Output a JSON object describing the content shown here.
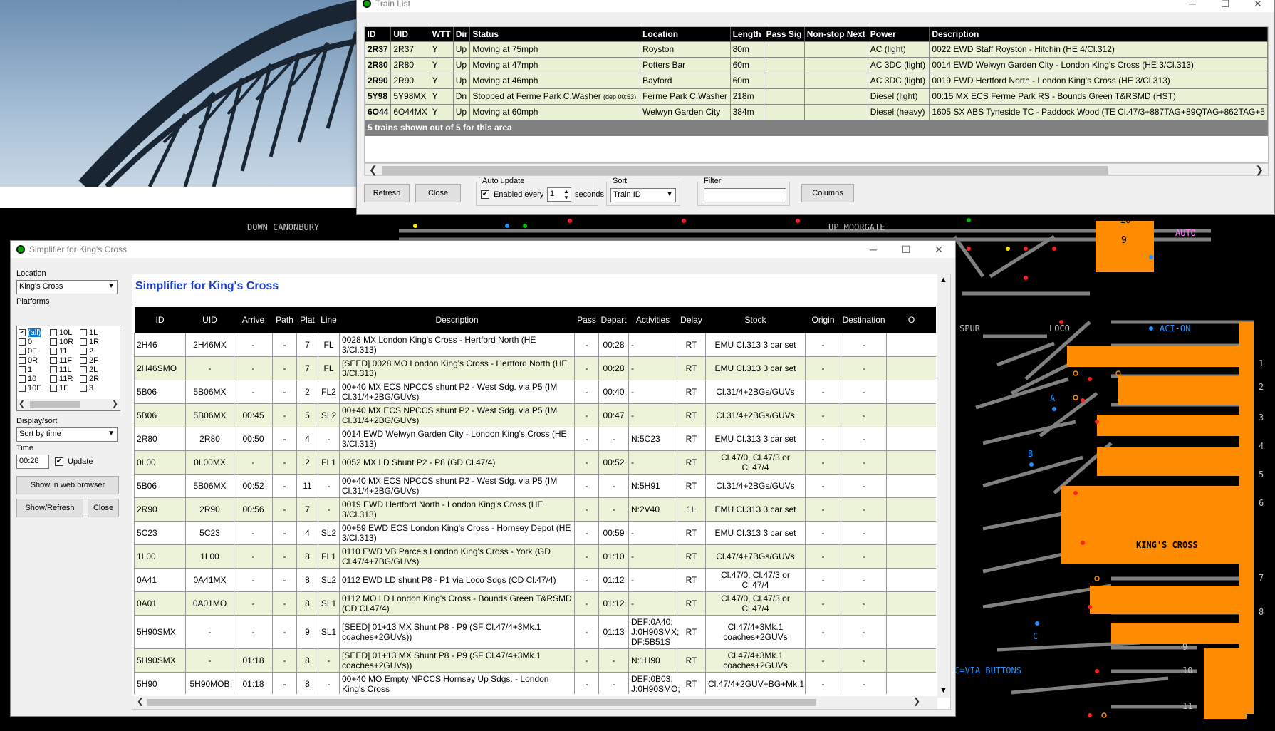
{
  "train_list": {
    "title": "Train List",
    "columns": [
      "ID",
      "UID",
      "WTT",
      "Dir",
      "Status",
      "Location",
      "Length",
      "Pass Sig",
      "Non-stop Next",
      "Power",
      "Description"
    ],
    "rows": [
      {
        "id": "2R37",
        "uid": "2R37",
        "wtt": "Y",
        "dir": "Up",
        "status": "Moving at 75mph",
        "status_note": "",
        "location": "Royston",
        "length": "80m",
        "pass_sig": "",
        "nonstop": "",
        "power": "AC (light)",
        "description": "0022 EWD Staff Royston - Hitchin (HE 4/Cl.312)"
      },
      {
        "id": "2R80",
        "uid": "2R80",
        "wtt": "Y",
        "dir": "Up",
        "status": "Moving at 47mph",
        "status_note": "",
        "location": "Potters Bar",
        "length": "60m",
        "pass_sig": "",
        "nonstop": "",
        "power": "AC 3DC (light)",
        "description": "0014 EWD Welwyn Garden City - London King's Cross (HE 3/Cl.313)"
      },
      {
        "id": "2R90",
        "uid": "2R90",
        "wtt": "Y",
        "dir": "Up",
        "status": "Moving at 46mph",
        "status_note": "",
        "location": "Bayford",
        "length": "60m",
        "pass_sig": "",
        "nonstop": "",
        "power": "AC 3DC (light)",
        "description": "0019 EWD Hertford North - London King's Cross (HE 3/Cl.313)"
      },
      {
        "id": "5Y98",
        "uid": "5Y98MX",
        "wtt": "Y",
        "dir": "Dn",
        "status": "Stopped at Ferme Park C.Washer",
        "status_note": "(dep 00:53)",
        "location": "Ferme Park C.Washer",
        "length": "218m",
        "pass_sig": "",
        "nonstop": "",
        "power": "Diesel (light)",
        "description": "00:15 MX ECS Ferme Park RS - Bounds Green T&RSMD (HST)"
      },
      {
        "id": "6O44",
        "uid": "6O44MX",
        "wtt": "Y",
        "dir": "Up",
        "status": "Moving at 60mph",
        "status_note": "",
        "location": "Welwyn Garden City",
        "length": "384m",
        "pass_sig": "",
        "nonstop": "",
        "power": "Diesel (heavy)",
        "description": "1605 SX ABS Tyneside TC - Paddock Wood (TE Cl.47/3+887TAG+89QTAG+862TAG+5"
      }
    ],
    "summary": "5 trains shown out of 5 for this area",
    "refresh_label": "Refresh",
    "close_label": "Close",
    "auto_update_label": "Auto update",
    "enabled_every_label": "Enabled every",
    "seconds_value": "1",
    "seconds_label": "seconds",
    "sort_label": "Sort",
    "sort_value": "Train ID",
    "filter_label": "Filter",
    "filter_value": "",
    "columns_label": "Columns"
  },
  "simplifier": {
    "title": "Simplifier for King's Cross",
    "heading": "Simplifier for King's Cross",
    "location_label": "Location",
    "location_value": "King's Cross",
    "platforms_label": "Platforms",
    "platforms": [
      {
        "label": "(all)",
        "checked": true
      },
      {
        "label": "0",
        "checked": false
      },
      {
        "label": "0F",
        "checked": false
      },
      {
        "label": "0R",
        "checked": false
      },
      {
        "label": "1",
        "checked": false
      },
      {
        "label": "10",
        "checked": false
      },
      {
        "label": "10F",
        "checked": false
      },
      {
        "label": "10L",
        "checked": false
      },
      {
        "label": "10R",
        "checked": false
      },
      {
        "label": "11",
        "checked": false
      },
      {
        "label": "11F",
        "checked": false
      },
      {
        "label": "11L",
        "checked": false
      },
      {
        "label": "11R",
        "checked": false
      },
      {
        "label": "1F",
        "checked": false
      },
      {
        "label": "1L",
        "checked": false
      },
      {
        "label": "1R",
        "checked": false
      },
      {
        "label": "2",
        "checked": false
      },
      {
        "label": "2F",
        "checked": false
      },
      {
        "label": "2L",
        "checked": false
      },
      {
        "label": "2R",
        "checked": false
      },
      {
        "label": "3",
        "checked": false
      }
    ],
    "display_sort_label": "Display/sort",
    "display_sort_value": "Sort by time",
    "time_label": "Time",
    "time_value": "00:28",
    "update_label": "Update",
    "show_web_label": "Show in web browser",
    "show_refresh_label": "Show/Refresh",
    "close_label": "Close",
    "columns": [
      "ID",
      "UID",
      "Arrive",
      "Path",
      "Plat",
      "Line",
      "Description",
      "Pass",
      "Depart",
      "Activities",
      "Delay",
      "Stock",
      "Origin",
      "Destination",
      "O"
    ],
    "rows": [
      [
        "2H46",
        "2H46MX",
        "-",
        "-",
        "7",
        "FL",
        "0028 MX London King's Cross - Hertford North (HE 3/Cl.313)",
        "-",
        "00:28",
        "-",
        "RT",
        "EMU Cl.313 3 car set",
        "-",
        "-"
      ],
      [
        "2H46SMO",
        "-",
        "-",
        "-",
        "7",
        "FL",
        "[SEED] 0028 MO London King's Cross - Hertford North (HE 3/Cl.313)",
        "-",
        "00:28",
        "-",
        "RT",
        "EMU Cl.313 3 car set",
        "-",
        "-"
      ],
      [
        "5B06",
        "5B06MX",
        "-",
        "-",
        "2",
        "FL2",
        "00+40 MX ECS NPCCS shunt P2 - West Sdg. via P5 (IM Cl.31/4+2BG/GUVs)",
        "-",
        "00:40",
        "-",
        "RT",
        "Cl.31/4+2BGs/GUVs",
        "-",
        "-"
      ],
      [
        "5B06",
        "5B06MX",
        "00:45",
        "-",
        "5",
        "SL2",
        "00+40 MX ECS NPCCS shunt P2 - West Sdg. via P5 (IM Cl.31/4+2BG/GUVs)",
        "-",
        "00:47",
        "-",
        "RT",
        "Cl.31/4+2BGs/GUVs",
        "-",
        "-"
      ],
      [
        "2R80",
        "2R80",
        "00:50",
        "-",
        "4",
        "-",
        "0014 EWD Welwyn Garden City - London King's Cross (HE 3/Cl.313)",
        "-",
        "-",
        "N:5C23",
        "RT",
        "EMU Cl.313 3 car set",
        "-",
        "-"
      ],
      [
        "0L00",
        "0L00MX",
        "-",
        "-",
        "2",
        "FL1",
        "0052 MX LD Shunt P2 - P8 (GD Cl.47/4)",
        "-",
        "00:52",
        "-",
        "RT",
        "Cl.47/0, Cl.47/3 or Cl.47/4",
        "-",
        "-"
      ],
      [
        "5B06",
        "5B06MX",
        "00:52",
        "-",
        "11",
        "-",
        "00+40 MX ECS NPCCS shunt P2 - West Sdg. via P5 (IM Cl.31/4+2BG/GUVs)",
        "-",
        "-",
        "N:5H91",
        "RT",
        "Cl.31/4+2BGs/GUVs",
        "-",
        "-"
      ],
      [
        "2R90",
        "2R90",
        "00:56",
        "-",
        "7",
        "-",
        "0019 EWD Hertford North - London King's Cross (HE 3/Cl.313)",
        "-",
        "-",
        "N:2V40",
        "1L",
        "EMU Cl.313 3 car set",
        "-",
        "-"
      ],
      [
        "5C23",
        "5C23",
        "-",
        "-",
        "4",
        "SL2",
        "00+59 EWD ECS London King's Cross - Hornsey Depot (HE 3/Cl.313)",
        "-",
        "00:59",
        "-",
        "RT",
        "EMU Cl.313 3 car set",
        "-",
        "-"
      ],
      [
        "1L00",
        "1L00",
        "-",
        "-",
        "8",
        "FL1",
        "0110 EWD VB Parcels London King's Cross - York (GD Cl.47/4+7BG/GUVs)",
        "-",
        "01:10",
        "-",
        "RT",
        "Cl.47/4+7BGs/GUVs",
        "-",
        "-"
      ],
      [
        "0A41",
        "0A41MX",
        "-",
        "-",
        "8",
        "SL2",
        "0112 EWD LD shunt P8 - P1 via Loco Sdgs (CD Cl.47/4)",
        "-",
        "01:12",
        "-",
        "RT",
        "Cl.47/0, Cl.47/3 or Cl.47/4",
        "-",
        "-"
      ],
      [
        "0A01",
        "0A01MO",
        "-",
        "-",
        "8",
        "SL1",
        "0112 MO LD London King's Cross - Bounds Green T&RSMD (CD Cl.47/4)",
        "-",
        "01:12",
        "-",
        "RT",
        "Cl.47/0, Cl.47/3 or Cl.47/4",
        "-",
        "-"
      ],
      [
        "5H90SMX",
        "-",
        "-",
        "-",
        "9",
        "SL1",
        "[SEED] 01+13 MX Shunt P8 - P9 (SF Cl.47/4+3Mk.1 coaches+2GUVs))",
        "-",
        "01:13",
        "DEF:0A40; J:0H90SMX; DF:5B51S",
        "RT",
        "Cl.47/4+3Mk.1 coaches+2GUVs",
        "-",
        "-"
      ],
      [
        "5H90SMX",
        "-",
        "01:18",
        "-",
        "8",
        "-",
        "[SEED] 01+13 MX Shunt P8 - P9 (SF Cl.47/4+3Mk.1 coaches+2GUVs))",
        "-",
        "-",
        "N:1H90",
        "RT",
        "Cl.47/4+3Mk.1 coaches+2GUVs",
        "-",
        "-"
      ],
      [
        "5H90",
        "5H90MOB",
        "01:18",
        "-",
        "8",
        "-",
        "00+40 MO Empty NPCCS Hornsey Up Sdgs. - London King's Cross",
        "-",
        "-",
        "DEF:0B03; J:0H90SMO;",
        "RT",
        "Cl.47/4+2GUV+BG+Mk.1",
        "-",
        "-"
      ]
    ]
  },
  "panel": {
    "labels": [
      "DOWN CANONBURY",
      "UP MOORGATE",
      "AUTO",
      "SPUR",
      "LOCO",
      "ACI-ON",
      "KING'S CROSS",
      "C=VIA BUTTONS",
      "A",
      "B",
      "C"
    ],
    "platform_numbers": [
      "1",
      "2",
      "3",
      "4",
      "5",
      "6",
      "7",
      "8",
      "9",
      "10",
      "11"
    ],
    "box_numbers": [
      "10",
      "9"
    ],
    "colors": {
      "platform": "#ff8c00",
      "track": "#808080",
      "signal_red": "#ff2020",
      "aspect_blue": "#1e90ff"
    }
  }
}
